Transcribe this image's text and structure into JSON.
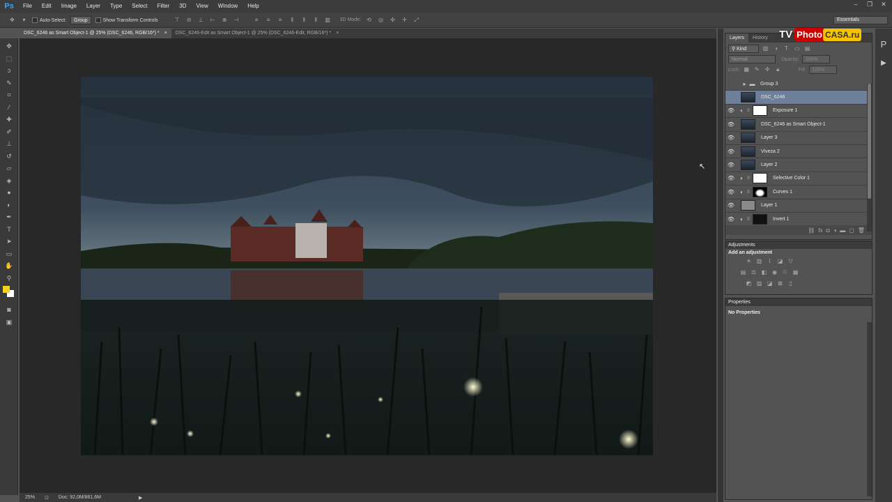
{
  "app": {
    "logo": "Ps"
  },
  "menu": [
    "File",
    "Edit",
    "Image",
    "Layer",
    "Type",
    "Select",
    "Filter",
    "3D",
    "View",
    "Window",
    "Help"
  ],
  "options_bar": {
    "auto_select_label": "Auto-Select:",
    "auto_select_value": "Group",
    "transform_label": "Show Transform Controls",
    "mode_3d_label": "3D Mode:",
    "workspace": "Essentials"
  },
  "tabs": [
    {
      "title": "DSC_6246 as Smart Object-1 @ 25% (DSC_6246, RGB/16*) *",
      "close": "×"
    },
    {
      "title": "DSC_6246-Edit as Smart Object-1 @ 25% (DSC_6246-Edit, RGB/16*) *",
      "close": "×"
    }
  ],
  "status": {
    "zoom": "25%",
    "doc": "Doc: 92,0M/861,6M"
  },
  "colors": {
    "foreground": "#f5d21d",
    "background": "#ffffff",
    "selection": "#6e7f99"
  },
  "layers_panel": {
    "tabs": [
      "Layers",
      "History"
    ],
    "filter_label": "Kind",
    "blend_mode": "Normal",
    "opacity_label": "Opacity:",
    "opacity_value": "100%",
    "lock_label": "Lock:",
    "fill_label": "Fill:",
    "fill_value": "100%",
    "layers": [
      {
        "name": "Group 3",
        "kind": "group",
        "visible": false
      },
      {
        "name": "DSC_6246",
        "kind": "photo",
        "visible": false,
        "selected": true
      },
      {
        "name": "Exposure 1",
        "kind": "adjust-white",
        "visible": true
      },
      {
        "name": "DSC_6246 as Smart Object-1",
        "kind": "photo",
        "visible": true
      },
      {
        "name": "Layer 3",
        "kind": "photo",
        "visible": true
      },
      {
        "name": "Viveza 2",
        "kind": "photo",
        "visible": true
      },
      {
        "name": "Layer 2",
        "kind": "photo",
        "visible": true
      },
      {
        "name": "Selective Color 1",
        "kind": "adjust-white",
        "visible": true
      },
      {
        "name": "Curves 1",
        "kind": "adjust-curve",
        "visible": true
      },
      {
        "name": "Layer 1",
        "kind": "gray",
        "visible": true
      },
      {
        "name": "Invert 1",
        "kind": "adjust-dark",
        "visible": true
      }
    ]
  },
  "adjustments_panel": {
    "title": "Adjustments",
    "subtitle": "Add an adjustment"
  },
  "properties_panel": {
    "title": "Properties",
    "text": "No Properties"
  },
  "watermark": {
    "tv": "TV",
    "photo": "Photo",
    "casa": "CASA.ru"
  }
}
